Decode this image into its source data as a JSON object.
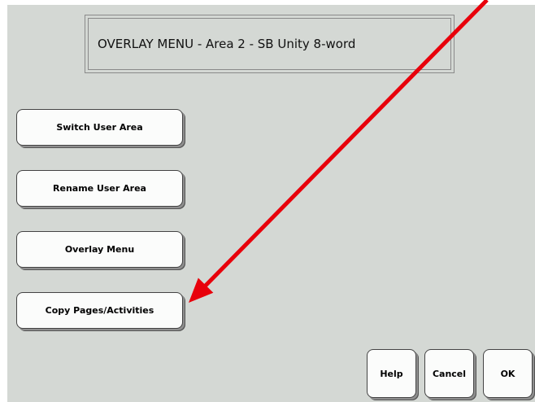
{
  "window": {
    "title": "OVERLAY MENU - Area 2 - SB Unity 8-word"
  },
  "menu": {
    "items": [
      {
        "label": "Switch User Area"
      },
      {
        "label": "Rename User Area"
      },
      {
        "label": "Overlay Menu"
      },
      {
        "label": "Copy Pages/Activities"
      }
    ]
  },
  "footer": {
    "help_label": "Help",
    "cancel_label": "Cancel",
    "ok_label": "OK"
  },
  "annotation": {
    "arrow_color": "#e8000b",
    "arrow_target": "Copy Pages/Activities"
  },
  "colors": {
    "background": "#d4d8d4",
    "button_face": "#fbfcfb"
  }
}
